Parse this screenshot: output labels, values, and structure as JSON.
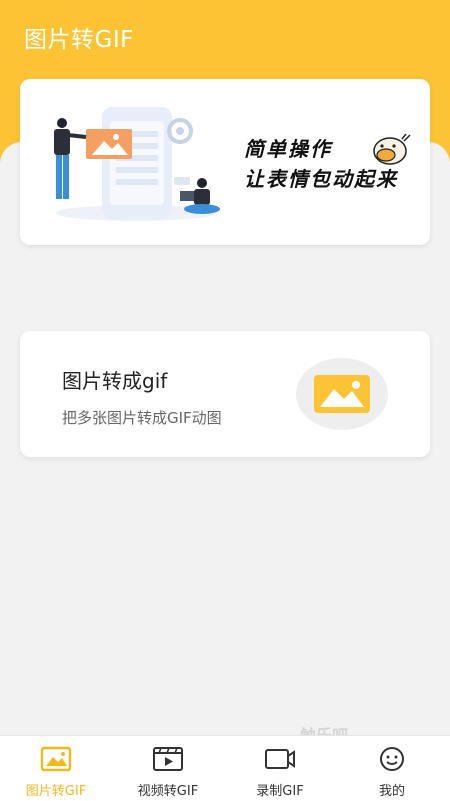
{
  "app": {
    "title": "图片转GIF"
  },
  "banner": {
    "line1": "简单操作",
    "line2": "让表情包动起来"
  },
  "feature": {
    "title": "图片转成gif",
    "description": "把多张图片转成GIF动图"
  },
  "bottom_nav": {
    "items": [
      {
        "label": "图片转GIF",
        "icon": "image-icon",
        "active": true
      },
      {
        "label": "视频转GIF",
        "icon": "video-icon",
        "active": false
      },
      {
        "label": "录制GIF",
        "icon": "record-icon",
        "active": false
      },
      {
        "label": "我的",
        "icon": "profile-icon",
        "active": false
      }
    ]
  },
  "watermark": "触乐吧",
  "colors": {
    "accent": "#fcc434",
    "active_nav": "#f5b81c",
    "background": "#f2f2f2"
  }
}
